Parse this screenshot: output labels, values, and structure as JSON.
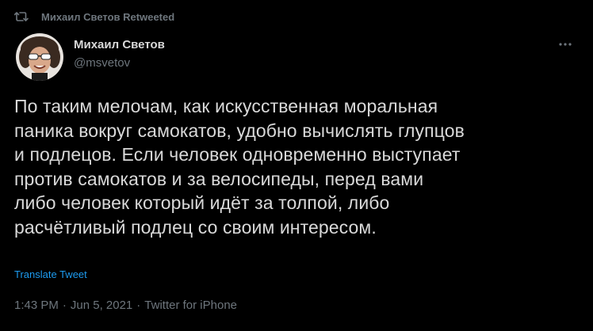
{
  "retweet": {
    "icon": "retweet-icon",
    "label": "Михаил Светов Retweeted"
  },
  "author": {
    "avatar_icon": "avatar",
    "display_name": "Михаил Светов",
    "handle": "@msvetov"
  },
  "more": {
    "icon": "more-icon"
  },
  "tweet": {
    "lines": [
      "По таким мелочам, как искусственная моральная",
      "паника вокруг самокатов, удобно вычислять глупцов",
      "и подлецов. Если человек одновременно выступает",
      "против самокатов и за велосипеды, перед вами",
      "либо человек который идёт за толпой, либо",
      "расчётливый подлец со своим интересом."
    ],
    "translate_label": "Translate Tweet"
  },
  "meta": {
    "time": "1:43 PM",
    "separator": "·",
    "date": "Jun 5, 2021",
    "source": "Twitter for iPhone"
  },
  "colors": {
    "background": "#000000",
    "text": "#d9d9d9",
    "secondary": "#6e767d",
    "link": "#1d9bf0"
  }
}
